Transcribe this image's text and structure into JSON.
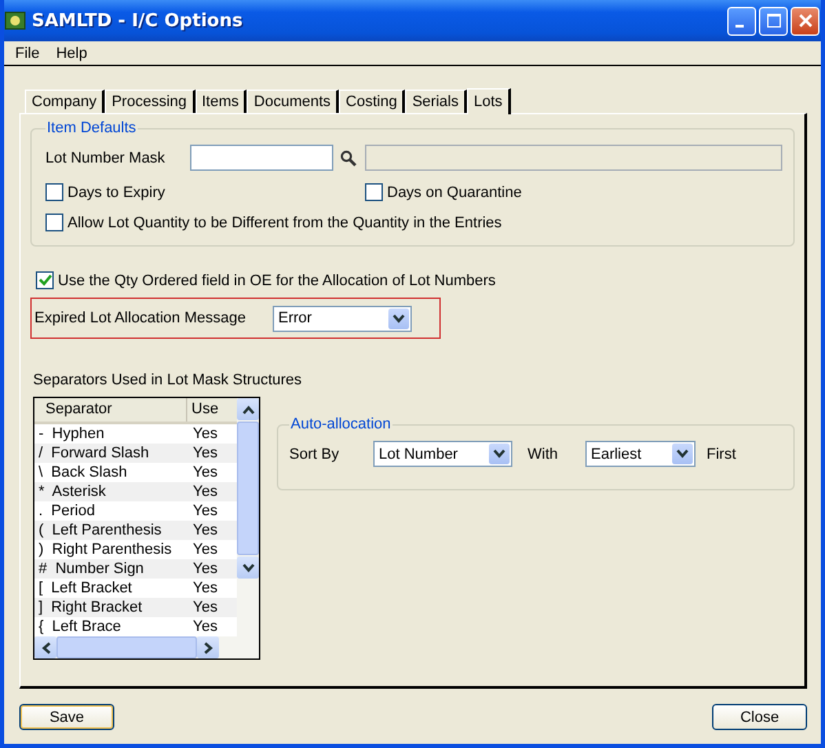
{
  "window": {
    "title": "SAMLTD - I/C Options"
  },
  "menu": [
    "File",
    "Help"
  ],
  "tabs": [
    {
      "label": "Company",
      "selected": false
    },
    {
      "label": "Processing",
      "selected": false
    },
    {
      "label": "Items",
      "selected": false
    },
    {
      "label": "Documents",
      "selected": false
    },
    {
      "label": "Costing",
      "selected": false
    },
    {
      "label": "Serials",
      "selected": false
    },
    {
      "label": "Lots",
      "selected": true
    }
  ],
  "item_defaults": {
    "title": "Item Defaults",
    "lot_number_mask": {
      "label": "Lot Number Mask"
    },
    "checkboxes": [
      {
        "label": "Days to Expiry",
        "checked": false
      },
      {
        "label": "Days on Quarantine",
        "checked": false
      },
      {
        "label": "Allow Lot Quantity to be Different from the Quantity in the Entries",
        "checked": false
      }
    ]
  },
  "use_qty_ordered": {
    "label": "Use the Qty Ordered field in OE for the Allocation of Lot Numbers",
    "checked": true
  },
  "expired_message": {
    "label": "Expired Lot Allocation Message",
    "value": "Error"
  },
  "separators": {
    "title": "Separators Used in Lot Mask Structures",
    "columns": [
      "Separator",
      "Use"
    ],
    "rows": [
      [
        "-  Hyphen",
        "Yes"
      ],
      [
        "/  Forward Slash",
        "Yes"
      ],
      [
        "\\  Back Slash",
        "Yes"
      ],
      [
        "*  Asterisk",
        "Yes"
      ],
      [
        ".  Period",
        "Yes"
      ],
      [
        "(  Left Parenthesis",
        "Yes"
      ],
      [
        ")  Right Parenthesis",
        "Yes"
      ],
      [
        "#  Number Sign",
        "Yes"
      ],
      [
        "[  Left Bracket",
        "Yes"
      ],
      [
        "]  Right Bracket",
        "Yes"
      ],
      [
        "{  Left Brace",
        "Yes"
      ]
    ]
  },
  "auto_allocation": {
    "title": "Auto-allocation",
    "sort_by_label": "Sort By",
    "sort_by": "Lot Number",
    "with_label": "With",
    "with": "Earliest",
    "suffix": "First"
  },
  "buttons": [
    "Save",
    "Close"
  ]
}
